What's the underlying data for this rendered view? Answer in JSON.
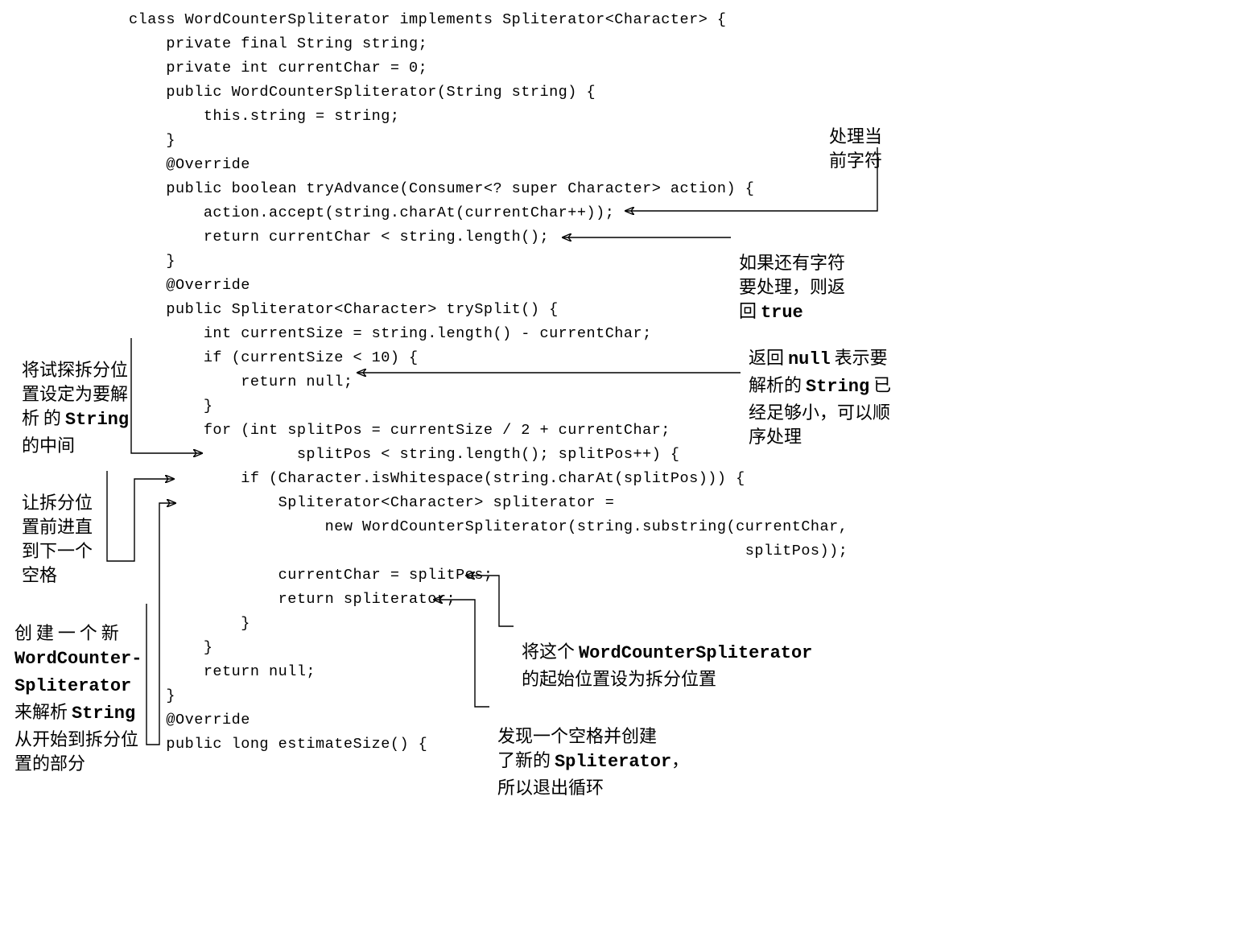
{
  "code": "class WordCounterSpliterator implements Spliterator<Character> {\n    private final String string;\n    private int currentChar = 0;\n    public WordCounterSpliterator(String string) {\n        this.string = string;\n    }\n    @Override\n    public boolean tryAdvance(Consumer<? super Character> action) {\n        action.accept(string.charAt(currentChar++));\n        return currentChar < string.length();\n    }\n    @Override\n    public Spliterator<Character> trySplit() {\n        int currentSize = string.length() - currentChar;\n        if (currentSize < 10) {\n            return null;\n        }\n        for (int splitPos = currentSize / 2 + currentChar;\n                  splitPos < string.length(); splitPos++) {\n            if (Character.isWhitespace(string.charAt(splitPos))) {\n                Spliterator<Character> spliterator =\n                     new WordCounterSpliterator(string.substring(currentChar,\n                                                                  splitPos));\n                currentChar = splitPos;\n                return spliterator;\n            }\n        }\n        return null;\n    }\n    @Override\n    public long estimateSize() {",
  "annotations": {
    "a1": {
      "pre": "处理当\n前字符"
    },
    "a2": {
      "pre": "如果还有字符\n要处理，则返\n回 ",
      "bold": "true"
    },
    "a3": {
      "pre": "返回 ",
      "b1": "null",
      "mid": " 表示要\n解析的 ",
      "b2": "String",
      "post": " 已\n经足够小，可以顺\n序处理"
    },
    "a4": {
      "pre": "将试探拆分位\n置设定为要解\n析 的 ",
      "b1": "String",
      "post": "\n的中间"
    },
    "a5": {
      "pre": "让拆分位\n置前进直\n到下一个\n空格"
    },
    "a6": {
      "pre": "创 建 一 个 新\n",
      "b1": "WordCounter-\nSpliterator",
      "mid": "\n来解析 ",
      "b2": "String",
      "post": "\n从开始到拆分位\n置的部分"
    },
    "a7": {
      "pre": "将这个 ",
      "b1": "WordCounterSpliterator",
      "post": "\n的起始位置设为拆分位置"
    },
    "a8": {
      "pre": "发现一个空格并创建\n了新的 ",
      "b1": "Spliterator",
      "post": "，\n所以退出循环"
    }
  }
}
